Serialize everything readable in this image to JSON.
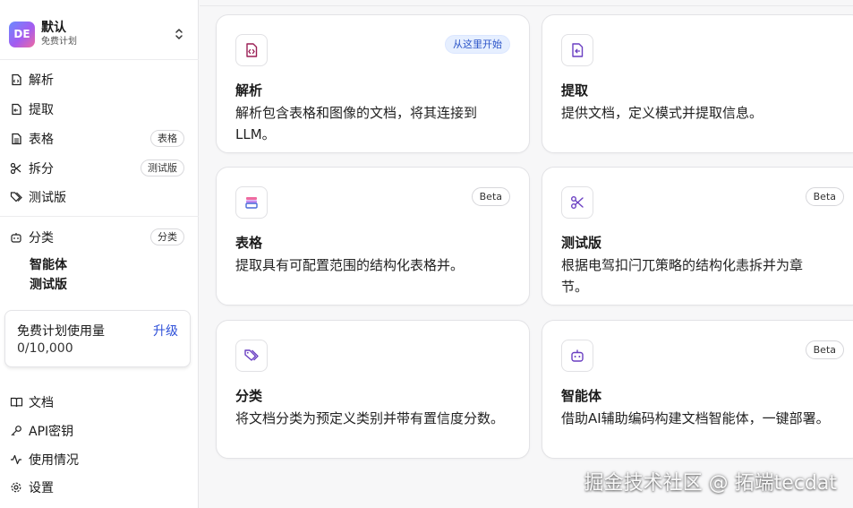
{
  "workspace": {
    "avatar": "DE",
    "name": "默认",
    "plan": "免费计划"
  },
  "nav": [
    {
      "label": "解析",
      "icon": "parse-icon"
    },
    {
      "label": "提取",
      "icon": "extract-icon"
    },
    {
      "label": "表格",
      "icon": "table-icon",
      "badge": "表格"
    },
    {
      "label": "拆分",
      "icon": "scissors-icon",
      "badge": "测试版"
    },
    {
      "label": "测试版",
      "icon": "tag-icon"
    }
  ],
  "classify": {
    "label": "分类",
    "badge": "分类",
    "sub": [
      "智能体",
      "测试版"
    ]
  },
  "usage": {
    "title": "免费计划使用量",
    "upgrade": "升级",
    "value": "0/10,000"
  },
  "bottom_nav": [
    {
      "label": "文档",
      "icon": "book-icon"
    },
    {
      "label": "API密钥",
      "icon": "key-icon"
    },
    {
      "label": "使用情况",
      "icon": "activity-icon"
    },
    {
      "label": "设置",
      "icon": "gear-icon"
    }
  ],
  "cards": [
    {
      "title": "解析",
      "desc": "解析包含表格和图像的文档，将其连接到LLM。",
      "badge": "从这里开始",
      "icon": "parse-doc-icon"
    },
    {
      "title": "提取",
      "desc": "提供文档，定义模式并提取信息。",
      "badge": "",
      "icon": "extract-doc-icon"
    },
    {
      "title": "表格",
      "desc": "提取具有可配置范围的结构化表格并。",
      "badge": "Beta",
      "icon": "table-stack-icon"
    },
    {
      "title": "测试版",
      "desc": "根据电驾扣闩兀策略的结构化恚拆并为章节。",
      "badge": "Beta",
      "icon": "scissors-icon"
    },
    {
      "title": "分类",
      "desc": "将文档分类为预定义类别并带有置信度分数。",
      "badge": "",
      "icon": "tags-icon"
    },
    {
      "title": "智能体",
      "desc": "借助AI辅助编码构建文档智能体，一键部署。",
      "badge": "Beta",
      "icon": "robot-icon"
    }
  ],
  "watermark": "掘金技术社区 @ 拓端tecdat",
  "colors": {
    "accent": "#2d4fd8",
    "icon": "#9b1f55",
    "violet": "#6a3fc2",
    "badge_start_bg": "#e6efff"
  }
}
